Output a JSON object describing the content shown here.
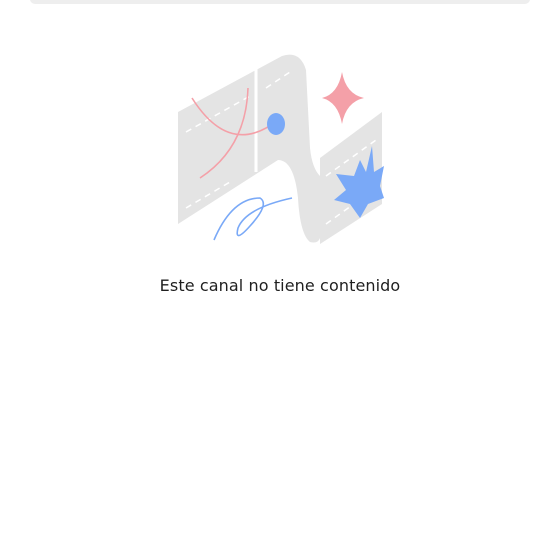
{
  "empty_state": {
    "illustration_icon": "empty-channel-illustration",
    "message": "Este canal no tiene contenido"
  },
  "colors": {
    "panel_gray": "#e3e3e3",
    "accent_pink": "#f4a0a8",
    "accent_blue": "#7aa9f7",
    "text": "#1f1f1f"
  }
}
